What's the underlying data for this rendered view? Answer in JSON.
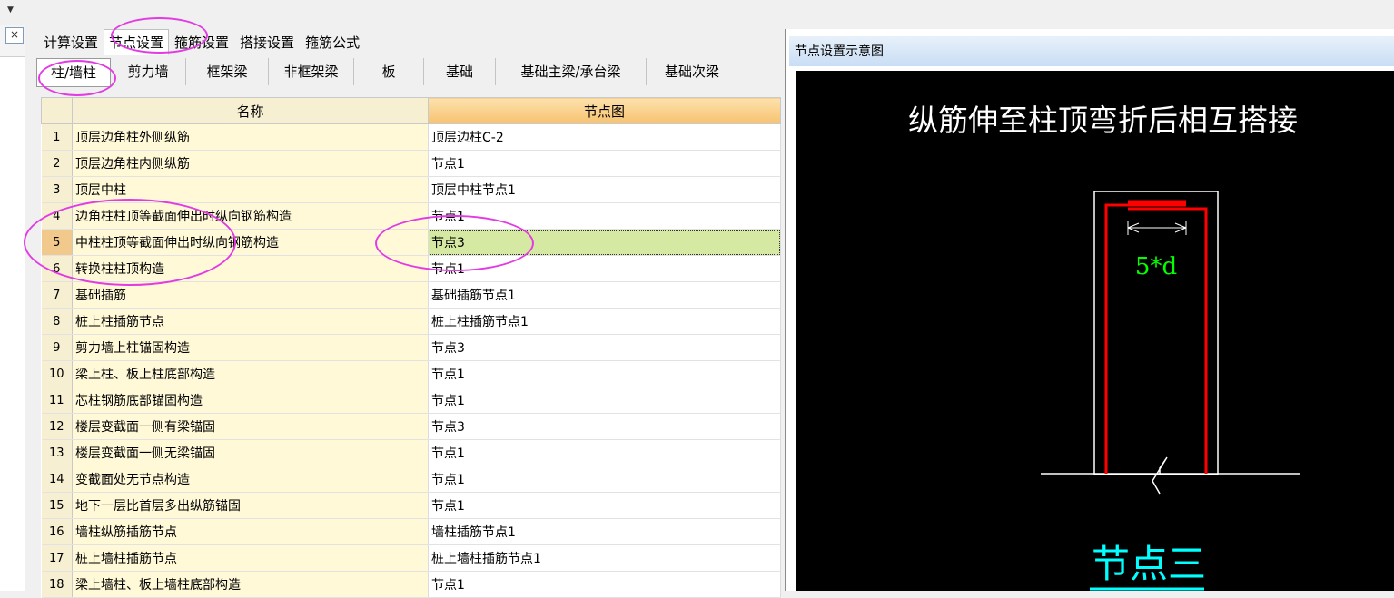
{
  "window": {
    "close_glyph": "×",
    "dropdown_glyph": "▼"
  },
  "tabs_level1": [
    "计算设置",
    "节点设置",
    "箍筋设置",
    "搭接设置",
    "箍筋公式"
  ],
  "active_tab_level1": 1,
  "tabs_level2": [
    "柱/墙柱",
    "剪力墙",
    "框架梁",
    "非框架梁",
    "板",
    "基础",
    "基础主梁/承台梁",
    "基础次梁"
  ],
  "active_tab_level2": 0,
  "table": {
    "headers": {
      "name": "名称",
      "node": "节点图"
    },
    "rows": [
      {
        "num": "1",
        "name": "顶层边角柱外侧纵筋",
        "node": "顶层边柱C-2"
      },
      {
        "num": "2",
        "name": "顶层边角柱内侧纵筋",
        "node": "节点1"
      },
      {
        "num": "3",
        "name": "顶层中柱",
        "node": "顶层中柱节点1"
      },
      {
        "num": "4",
        "name": "边角柱柱顶等截面伸出时纵向钢筋构造",
        "node": "节点1"
      },
      {
        "num": "5",
        "name": "中柱柱顶等截面伸出时纵向钢筋构造",
        "node": "节点3"
      },
      {
        "num": "6",
        "name": "转换柱柱顶构造",
        "node": "节点1"
      },
      {
        "num": "7",
        "name": "基础插筋",
        "node": "基础插筋节点1"
      },
      {
        "num": "8",
        "name": "桩上柱插筋节点",
        "node": "桩上柱插筋节点1"
      },
      {
        "num": "9",
        "name": "剪力墙上柱锚固构造",
        "node": "节点3"
      },
      {
        "num": "10",
        "name": "梁上柱、板上柱底部构造",
        "node": "节点1"
      },
      {
        "num": "11",
        "name": "芯柱钢筋底部锚固构造",
        "node": "节点1"
      },
      {
        "num": "12",
        "name": "楼层变截面一侧有梁锚固",
        "node": "节点3"
      },
      {
        "num": "13",
        "name": "楼层变截面一侧无梁锚固",
        "node": "节点1"
      },
      {
        "num": "14",
        "name": "变截面处无节点构造",
        "node": "节点1"
      },
      {
        "num": "15",
        "name": "地下一层比首层多出纵筋锚固",
        "node": "节点1"
      },
      {
        "num": "16",
        "name": "墙柱纵筋插筋节点",
        "node": "墙柱插筋节点1"
      },
      {
        "num": "17",
        "name": "桩上墙柱插筋节点",
        "node": "桩上墙柱插筋节点1"
      },
      {
        "num": "18",
        "name": "梁上墙柱、板上墙柱底部构造",
        "node": "节点1"
      }
    ],
    "selected_row": 4
  },
  "preview": {
    "title": "节点设置示意图",
    "diagram_heading": "纵筋伸至柱顶弯折后相互搭接",
    "dimension_label": "5*d",
    "node_caption": "节点三",
    "colors": {
      "background": "#000000",
      "rebar": "#ff0000",
      "outline": "#ffffff",
      "dimension": "#00ff00",
      "caption": "#00ffff",
      "heading": "#ffffff"
    }
  },
  "annotations": {
    "color": "#e33be3"
  }
}
